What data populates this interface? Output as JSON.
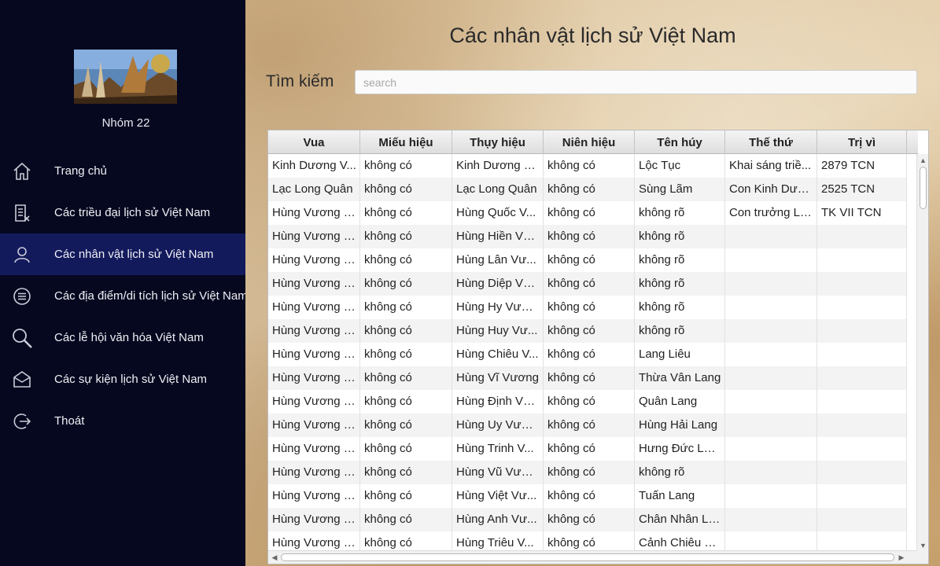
{
  "sidebar": {
    "group_name": "Nhóm 22",
    "items": [
      {
        "label": "Trang chủ",
        "icon": "home-icon",
        "active": false
      },
      {
        "label": "Các triều đại lịch sử Việt Nam",
        "icon": "document-icon",
        "active": false
      },
      {
        "label": "Các nhân vật lịch sử Việt Nam",
        "icon": "user-icon",
        "active": true
      },
      {
        "label": "Các địa điểm/di tích lịch sử Việt Nam",
        "icon": "list-circle-icon",
        "active": false
      },
      {
        "label": "Các lễ hội văn hóa Việt Nam",
        "icon": "search-icon",
        "active": false
      },
      {
        "label": "Các sự kiện lịch sử Việt Nam",
        "icon": "mail-icon",
        "active": false
      },
      {
        "label": "Thoát",
        "icon": "logout-icon",
        "active": false
      }
    ]
  },
  "main": {
    "title": "Các nhân vật lịch sử Việt Nam",
    "search_label": "Tìm kiếm",
    "search_placeholder": "search",
    "search_value": ""
  },
  "table": {
    "columns": [
      "Vua",
      "Miếu hiệu",
      "Thụy hiệu",
      "Niên hiệu",
      "Tên húy",
      "Thế thứ",
      "Trị vì"
    ],
    "rows": [
      [
        "Kinh Dương V...",
        "không có",
        "Kinh Dương V...",
        "không có",
        "Lộc Tục",
        "Khai sáng triề...",
        "2879 TCN"
      ],
      [
        "Lạc Long Quân",
        "không có",
        "Lạc Long Quân",
        "không có",
        "Sùng Lãm",
        "Con Kinh Dươ...",
        "2525 TCN"
      ],
      [
        "Hùng Vương t...",
        "không có",
        "Hùng Quốc V...",
        "không có",
        "không rõ",
        "Con trưởng Lạ...",
        "TK VII TCN"
      ],
      [
        "Hùng Vương t...",
        "không có",
        "Hùng Hiền Vư...",
        "không có",
        "không rõ",
        "",
        ""
      ],
      [
        "Hùng Vương t...",
        "không có",
        "Hùng Lân Vư...",
        "không có",
        "không rõ",
        "",
        ""
      ],
      [
        "Hùng Vương t...",
        "không có",
        "Hùng Diệp Vư...",
        "không có",
        "không rõ",
        "",
        ""
      ],
      [
        "Hùng Vương t...",
        "không có",
        "Hùng Hy Vương",
        "không có",
        "không rõ",
        "",
        ""
      ],
      [
        "Hùng Vương t...",
        "không có",
        "Hùng Huy Vư...",
        "không có",
        "không rõ",
        "",
        ""
      ],
      [
        "Hùng Vương t...",
        "không có",
        "Hùng Chiêu V...",
        "không có",
        "Lang Liêu",
        "",
        ""
      ],
      [
        "Hùng Vương t...",
        "không có",
        "Hùng Vĩ Vương",
        "không có",
        "Thừa Vân Lang",
        "",
        ""
      ],
      [
        "Hùng Vương t...",
        "không có",
        "Hùng Định Vư...",
        "không có",
        "Quân Lang",
        "",
        ""
      ],
      [
        "Hùng Vương t...",
        "không có",
        "Hùng Uy Vương",
        "không có",
        "Hùng Hải Lang",
        "",
        ""
      ],
      [
        "Hùng Vương t...",
        "không có",
        "Hùng Trinh V...",
        "không có",
        "Hưng Đức Lang",
        "",
        ""
      ],
      [
        "Hùng Vương t...",
        "không có",
        "Hùng Vũ Vương",
        "không có",
        "không rõ",
        "",
        ""
      ],
      [
        "Hùng Vương t...",
        "không có",
        "Hùng Việt Vư...",
        "không có",
        "Tuấn Lang",
        "",
        ""
      ],
      [
        "Hùng Vương t...",
        "không có",
        "Hùng Anh Vư...",
        "không có",
        "Chân Nhân La...",
        "",
        ""
      ],
      [
        "Hùng Vương t...",
        "không có",
        "Hùng Triêu V...",
        "không có",
        "Cảnh Chiêu La...",
        "",
        ""
      ]
    ]
  }
}
